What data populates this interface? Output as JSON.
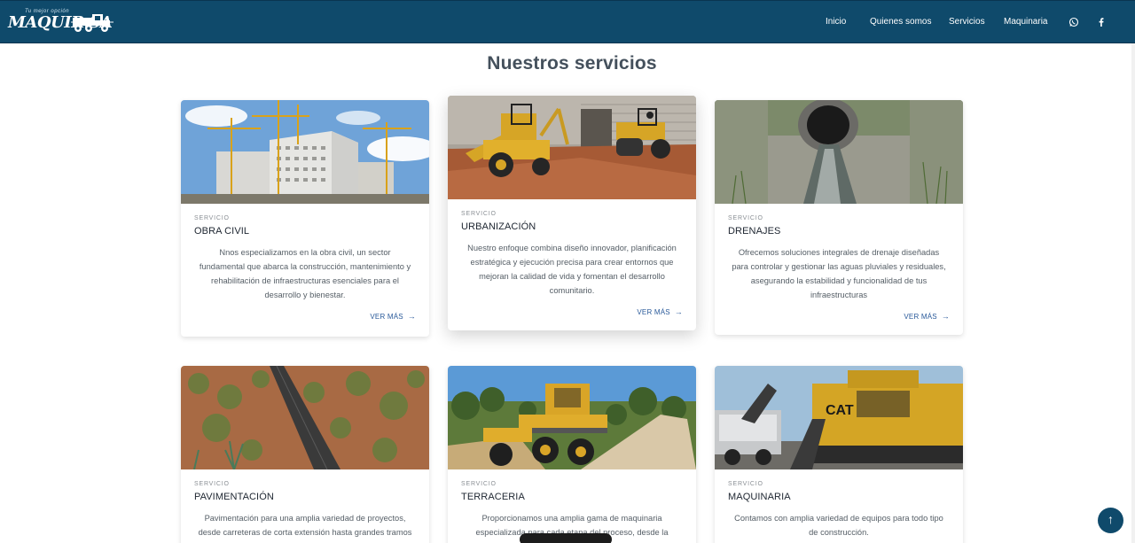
{
  "nav": {
    "logo_text": "MAQUIR.SA",
    "logo_small": "Tu mejor opción",
    "links": [
      "Inicio",
      "Quienes somos",
      "Servicios",
      "Maquinaria"
    ],
    "icons": [
      "whatsapp-icon",
      "facebook-icon"
    ],
    "bg_color": "#0f4a6b"
  },
  "section": {
    "title": "Nuestros servicios"
  },
  "cards": [
    {
      "eyebrow": "SERVICIO",
      "title": "OBRA CIVIL",
      "text": "Nnos especializamos en la obra civil, un sector fundamental que abarca la construcción, mantenimiento y rehabilitación de infraestructuras esenciales para el desarrollo y bienestar.",
      "link": "VER MÁS"
    },
    {
      "eyebrow": "SERVICIO",
      "title": "URBANIZACIÓN",
      "text": "Nuestro enfoque combina diseño innovador, planificación estratégica y ejecución precisa para crear entornos que mejoran la calidad de vida y fomentan el desarrollo comunitario.",
      "link": "VER MÁS"
    },
    {
      "eyebrow": "SERVICIO",
      "title": "DRENAJES",
      "text": "Ofrecemos soluciones integrales de drenaje diseñadas para controlar y gestionar las aguas pluviales y residuales, asegurando la estabilidad y funcionalidad de tus infraestructuras",
      "link": "VER MÁS"
    },
    {
      "eyebrow": "SERVICIO",
      "title": "PAVIMENTACIÓN",
      "text": "Pavimentación para una amplia variedad de proyectos, desde carreteras de corta extensión hasta grandes tramos",
      "link": ""
    },
    {
      "eyebrow": "SERVICIO",
      "title": "TERRACERIA",
      "text": "Proporcionamos una amplia gama de maquinaria especializada para cada etapa del proceso, desde la",
      "link": ""
    },
    {
      "eyebrow": "SERVICIO",
      "title": "MAQUINARIA",
      "text": "Contamos con amplia variedad de equipos para todo tipo de construcción.",
      "link": ""
    }
  ],
  "scroll_top_icon": "arrow-up-icon"
}
